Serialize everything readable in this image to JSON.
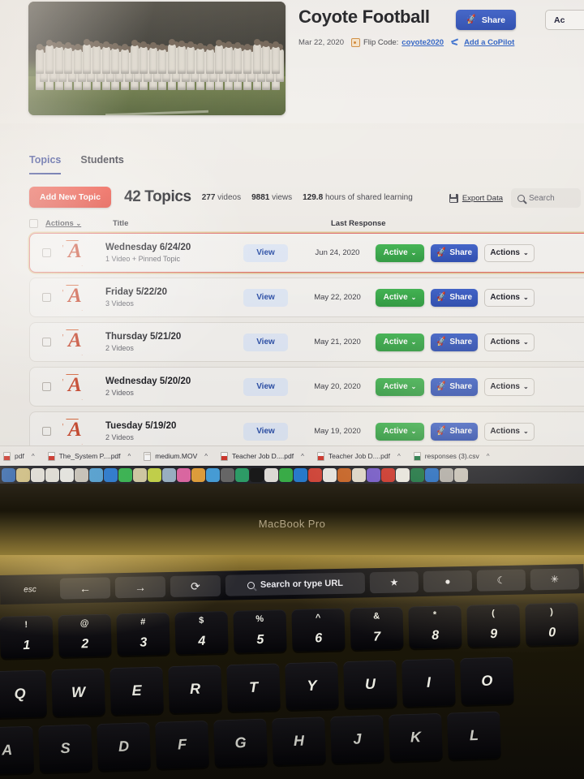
{
  "app": {
    "header": {
      "title": "Coyote Football",
      "date": "Mar 22, 2020",
      "flip_code_label": "Flip Code:",
      "flip_code": "coyote2020",
      "copilot": "Add a CoPilot",
      "share_button": "Share",
      "secondary_button": "Ac",
      "share_icon": "rocket-icon",
      "flip_icon": "flip-code-icon",
      "copilot_icon": "copilot-icon"
    },
    "tabs": [
      {
        "label": "Topics",
        "active": true
      },
      {
        "label": "Students",
        "active": false
      }
    ],
    "toolbar": {
      "add_topic": "Add New Topic",
      "topic_count": "42 Topics",
      "videos_value": "277",
      "videos_label": "videos",
      "views_value": "9881",
      "views_label": "views",
      "hours_value": "129.8",
      "hours_label": "hours of shared learning",
      "export": "Export Data",
      "export_icon": "floppy-disk-icon",
      "search_placeholder": "Search",
      "search_value": "",
      "search_icon": "search-icon"
    },
    "columns": {
      "actions": "Actions",
      "title": "Title",
      "last_response": "Last Response"
    },
    "row_actions": {
      "view": "View",
      "active": "Active",
      "share": "Share",
      "actions": "Actions",
      "caret": "⌄"
    },
    "topics": [
      {
        "title": "Wednesday 6/24/20",
        "sub": "1 Video + Pinned Topic",
        "date": "Jun 24, 2020",
        "selected": true
      },
      {
        "title": "Friday 5/22/20",
        "sub": "3 Videos",
        "date": "May 22, 2020",
        "selected": false
      },
      {
        "title": "Thursday 5/21/20",
        "sub": "2 Videos",
        "date": "May 21, 2020",
        "selected": false
      },
      {
        "title": "Wednesday 5/20/20",
        "sub": "2 Videos",
        "date": "May 20, 2020",
        "selected": false
      },
      {
        "title": "Tuesday 5/19/20",
        "sub": "2 Videos",
        "date": "May 19, 2020",
        "selected": false
      }
    ],
    "downloads": [
      {
        "name": "pdf",
        "kind": "pdf"
      },
      {
        "name": "The_System P....pdf",
        "kind": "pdf"
      },
      {
        "name": "medium.MOV",
        "kind": "mov"
      },
      {
        "name": "Teacher Job D....pdf",
        "kind": "pdf"
      },
      {
        "name": "Teacher Job D....pdf",
        "kind": "pdf"
      },
      {
        "name": "responses (3).csv",
        "kind": "csv"
      }
    ]
  },
  "laptop": {
    "model": "MacBook Pro",
    "touchbar": {
      "esc": "esc",
      "back": "←",
      "forward": "→",
      "reload": "⟳",
      "url_placeholder": "Search or type URL",
      "url_icon": "search-icon",
      "star": "★",
      "profile": "●",
      "moon": "☾",
      "brightness": "✳"
    },
    "keyboard": {
      "number_row": [
        {
          "sym": "!",
          "num": "1"
        },
        {
          "sym": "@",
          "num": "2"
        },
        {
          "sym": "#",
          "num": "3"
        },
        {
          "sym": "$",
          "num": "4"
        },
        {
          "sym": "%",
          "num": "5"
        },
        {
          "sym": "^",
          "num": "6"
        },
        {
          "sym": "&",
          "num": "7"
        },
        {
          "sym": "*",
          "num": "8"
        },
        {
          "sym": "(",
          "num": "9"
        },
        {
          "sym": ")",
          "num": "0"
        }
      ],
      "letter_row_1": [
        "Q",
        "W",
        "E",
        "R",
        "T",
        "Y",
        "U",
        "I",
        "O"
      ],
      "letter_row_2": [
        "A",
        "S",
        "D",
        "F",
        "G",
        "H",
        "J",
        "K",
        "L"
      ]
    }
  },
  "colors": {
    "accent_blue": "#2b4bb0",
    "accent_red": "#e03c2d",
    "accent_green": "#2e9a3f",
    "link": "#2b5fc4",
    "tab_active": "#2b3a8f",
    "logo_red": "#c9452a"
  }
}
